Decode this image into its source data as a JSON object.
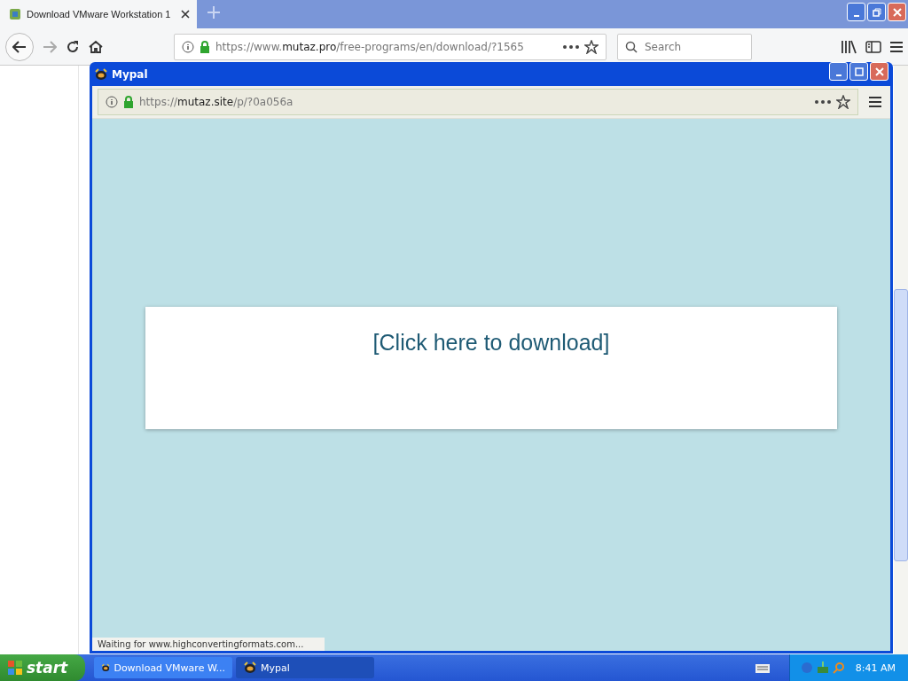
{
  "browser": {
    "tab": {
      "title": "Download VMware Workstation 1",
      "selected": true
    },
    "url": {
      "prefix": "https://www.",
      "host": "mutaz.pro",
      "path": "/free-programs/en/download/?1565"
    },
    "search": {
      "placeholder": "Search"
    }
  },
  "popup": {
    "title": "Mypal",
    "url": {
      "prefix": "https://",
      "host": "mutaz.site",
      "path": "/p/?0a056a"
    },
    "link": "[Click here to download]",
    "status": "Waiting for www.highconvertingformats.com..."
  },
  "taskbar": {
    "start": "start",
    "items": [
      {
        "label": "Download VMware W...",
        "selected": false
      },
      {
        "label": "Mypal",
        "selected": true
      }
    ],
    "clock": "8:41 AM"
  }
}
